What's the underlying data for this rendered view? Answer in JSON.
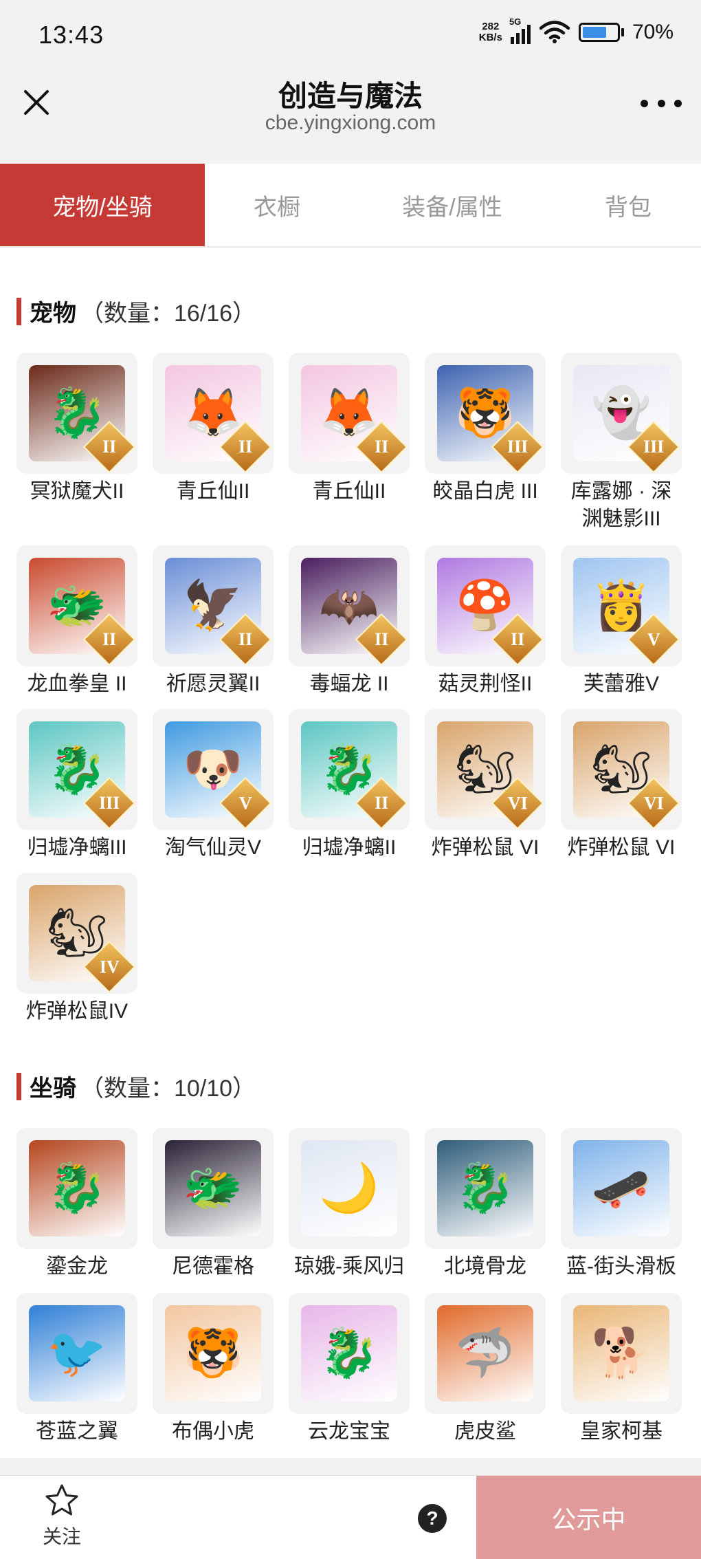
{
  "status": {
    "time": "13:43",
    "speed_value": "282",
    "speed_unit": "KB/s",
    "network": "5G",
    "battery": "70%"
  },
  "titlebar": {
    "title": "创造与魔法",
    "subtitle": "cbe.yingxiong.com"
  },
  "tabs": [
    {
      "label": "宠物/坐骑",
      "active": true
    },
    {
      "label": "衣橱",
      "active": false
    },
    {
      "label": "装备/属性",
      "active": false
    },
    {
      "label": "背包",
      "active": false
    }
  ],
  "pets": {
    "title": "宠物",
    "count": "（数量：16/16）",
    "items": [
      {
        "label": "冥狱魔犬II",
        "rank": "II",
        "icon": "dragon-dog-icon",
        "color": "#6b2a1a"
      },
      {
        "label": "青丘仙II",
        "rank": "II",
        "icon": "fox-fairy-icon",
        "color": "#f3c6e0"
      },
      {
        "label": "青丘仙II",
        "rank": "II",
        "icon": "fox-fairy-icon",
        "color": "#f3c6e0"
      },
      {
        "label": "皎晶白虎 III",
        "rank": "III",
        "icon": "white-tiger-icon",
        "color": "#3d63b0"
      },
      {
        "label": "库露娜 · 深渊魅影III",
        "rank": "III",
        "icon": "ghost-girl-icon",
        "color": "#e8e8f5"
      },
      {
        "label": "龙血拳皇 II",
        "rank": "II",
        "icon": "red-beast-icon",
        "color": "#c94a2e"
      },
      {
        "label": "祈愿灵翼II",
        "rank": "II",
        "icon": "blue-bird-icon",
        "color": "#6a8ed6"
      },
      {
        "label": "毒蝠龙 II",
        "rank": "II",
        "icon": "bat-dragon-icon",
        "color": "#4a1f5e"
      },
      {
        "label": "菇灵荆怪II",
        "rank": "II",
        "icon": "mushroom-sprite-icon",
        "color": "#b07ae0"
      },
      {
        "label": "芙蕾雅V",
        "rank": "V",
        "icon": "valkyrie-icon",
        "color": "#9ec4f0"
      },
      {
        "label": "归墟净螭III",
        "rank": "III",
        "icon": "jade-dragon-icon",
        "color": "#5cc6c2"
      },
      {
        "label": "淘气仙灵V",
        "rank": "V",
        "icon": "blue-puppy-icon",
        "color": "#3f9ae0"
      },
      {
        "label": "归墟净螭II",
        "rank": "II",
        "icon": "jade-dragon-icon",
        "color": "#5cc6c2"
      },
      {
        "label": "炸弹松鼠 VI",
        "rank": "VI",
        "icon": "squirrel-icon",
        "color": "#d9a46a"
      },
      {
        "label": "炸弹松鼠 VI",
        "rank": "VI",
        "icon": "squirrel-icon",
        "color": "#d9a46a"
      },
      {
        "label": "炸弹松鼠IV",
        "rank": "IV",
        "icon": "squirrel-icon",
        "color": "#d9a46a"
      }
    ]
  },
  "mounts": {
    "title": "坐骑",
    "count": "（数量：10/10）",
    "items": [
      {
        "label": "鎏金龙",
        "icon": "golden-dragon-icon",
        "color": "#b4461e"
      },
      {
        "label": "尼德霍格",
        "icon": "dark-dragon-icon",
        "color": "#2a2236"
      },
      {
        "label": "琼娥-乘风归",
        "icon": "moon-lady-icon",
        "color": "#dfe6f2"
      },
      {
        "label": "北境骨龙",
        "icon": "frost-dragon-icon",
        "color": "#2f5d7a"
      },
      {
        "label": "蓝-街头滑板",
        "icon": "skateboard-icon",
        "color": "#7fb3ea"
      },
      {
        "label": "苍蓝之翼",
        "icon": "blue-wyvern-icon",
        "color": "#2f7fd6"
      },
      {
        "label": "布偶小虎",
        "icon": "toy-tiger-icon",
        "color": "#f2c7a0"
      },
      {
        "label": "云龙宝宝",
        "icon": "baby-dragon-icon",
        "color": "#e7b6e8"
      },
      {
        "label": "虎皮鲨",
        "icon": "tiger-shark-icon",
        "color": "#e06a2a"
      },
      {
        "label": "皇家柯基",
        "icon": "royal-corgi-icon",
        "color": "#e9b676"
      }
    ]
  },
  "bottom": {
    "follow_label": "关注",
    "help_label": "?",
    "public_label": "公示中"
  },
  "colors": {
    "accent": "#c53a35",
    "public_button": "#e09a9a"
  }
}
